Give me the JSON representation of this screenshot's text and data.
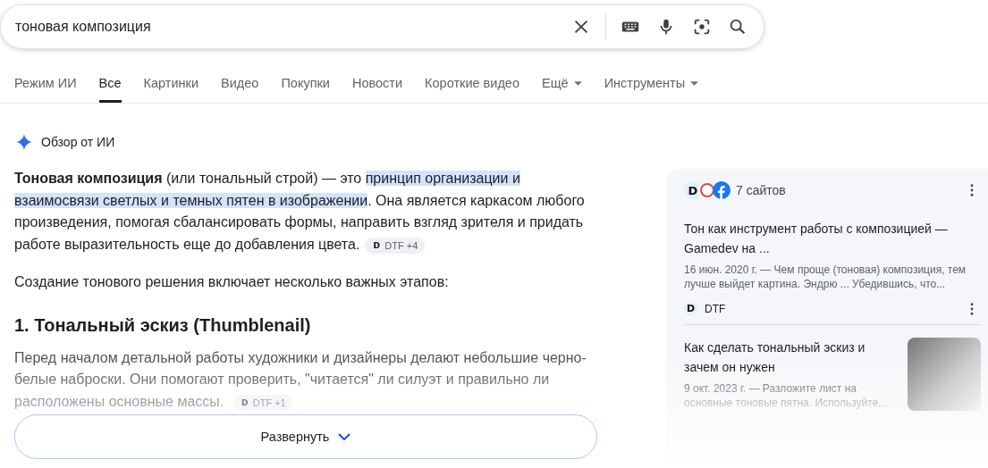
{
  "search": {
    "value": "тоновая композиция"
  },
  "tabs": [
    {
      "label": "Режим ИИ",
      "selected": false,
      "dropdown": false
    },
    {
      "label": "Все",
      "selected": true,
      "dropdown": false
    },
    {
      "label": "Картинки",
      "selected": false,
      "dropdown": false
    },
    {
      "label": "Видео",
      "selected": false,
      "dropdown": false
    },
    {
      "label": "Покупки",
      "selected": false,
      "dropdown": false
    },
    {
      "label": "Новости",
      "selected": false,
      "dropdown": false
    },
    {
      "label": "Короткие видео",
      "selected": false,
      "dropdown": false
    },
    {
      "label": "Ещё",
      "selected": false,
      "dropdown": true
    },
    {
      "label": "Инструменты",
      "selected": false,
      "dropdown": true
    }
  ],
  "overview": {
    "title": "Обзор от ИИ",
    "intro": {
      "segments": [
        {
          "text": "**Тоновая композиция** (или тональный строй) — это ",
          "highlighted": false
        },
        {
          "text": "принцип организации и взаимосвязи светлых и темных пятен в изображении",
          "highlighted": true
        },
        {
          "text": ". Она является каркасом любого произведения, помогая сбалансировать формы, направить взгляд зрителя и придать работе выразительность еще до добавления цвета.",
          "highlighted": false
        }
      ],
      "chip": {
        "logo": "D",
        "label": "DTF +4"
      }
    },
    "lead": "Создание тонового решения включает несколько важных этапов:",
    "heading": "1. Тональный эскиз (Thumblenail)",
    "faded_paragraph": {
      "text": "Перед началом детальной работы художники и дизайнеры делают небольшие черно-белые наброски. Они помогают проверить, \"читается\" ли силуэт и правильно ли расположены основные массы.",
      "chip": {
        "logo": "D",
        "label": "DTF +1"
      }
    },
    "expand_button": "Развернуть"
  },
  "sources": {
    "logo": "D",
    "count": "7 сайтов",
    "items": [
      {
        "title": "Тон как инструмент работы с композицией — Gamedev на ...",
        "snippet": "16 июн. 2020 г. — Чем проще (тоновая) композиция, тем лучше выйдет картина. Эндрю ... Убедившись, что...",
        "source": "DTF",
        "source_logo": "D",
        "thumbnail": false
      },
      {
        "title": "Как сделать тональный эскиз и зачем он нужен",
        "snippet": "9 окт. 2023 г. — Разложите лист на основные тоновые пятна. Используйте...",
        "thumbnail": true
      }
    ]
  }
}
